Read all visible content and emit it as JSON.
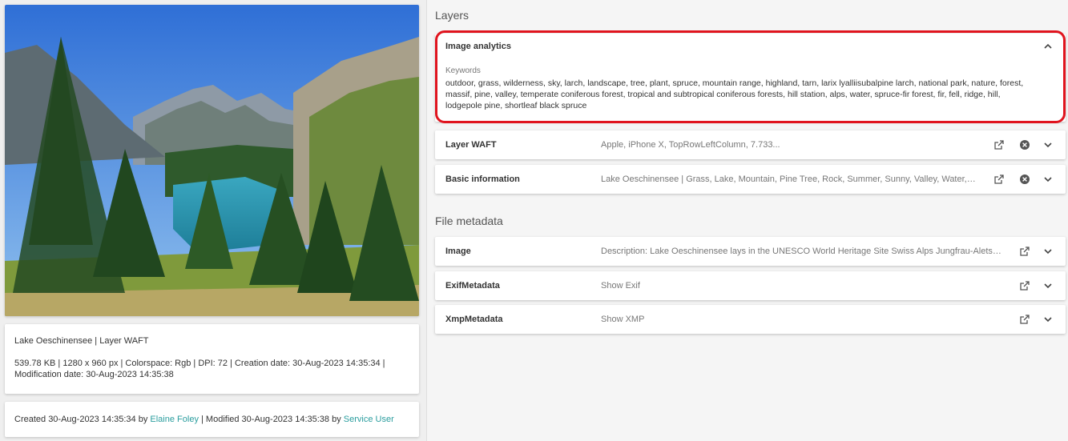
{
  "left": {
    "info_title": "Lake Oeschinensee | Layer WAFT",
    "info_details": "539.78 KB | 1280 x 960 px | Colorspace: Rgb | DPI: 72 | Creation date: 30-Aug-2023 14:35:34 | Modification date: 30-Aug-2023 14:35:38",
    "created_prefix": "Created 30-Aug-2023 14:35:34 by ",
    "created_by": "Elaine Foley",
    "modified_prefix": " | Modified 30-Aug-2023 14:35:38 by ",
    "modified_by": "Service User"
  },
  "layers": {
    "section_title": "Layers",
    "image_analytics": {
      "title": "Image analytics",
      "keywords_label": "Keywords",
      "keywords": "outdoor, grass, wilderness, sky, larch, landscape, tree, plant, spruce, mountain range, highland, tarn, larix lyalliisubalpine larch, national park, nature, forest, massif, pine, valley, temperate coniferous forest, tropical and subtropical coniferous forests, hill station, alps, water, spruce-fir forest, fir, fell, ridge, hill, lodgepole pine, shortleaf black spruce"
    },
    "layer_waft": {
      "title": "Layer WAFT",
      "summary": "Apple, iPhone X, TopRowLeftColumn, 7.733..."
    },
    "basic_information": {
      "title": "Basic information",
      "summary": "Lake Oeschinensee | Grass, Lake, Mountain, Pine Tree, Rock, Summer, Sunny, Valley, Water, Unesco ..."
    }
  },
  "file_metadata": {
    "section_title": "File metadata",
    "image": {
      "title": "Image",
      "summary": "Description: Lake Oeschinensee lays in the UNESCO World Heritage Site Swiss Alps Jungfrau-Aletsch just a..."
    },
    "exif": {
      "title": "ExifMetadata",
      "summary": "Show Exif"
    },
    "xmp": {
      "title": "XmpMetadata",
      "summary": "Show XMP"
    }
  },
  "colors": {
    "accent_link": "#2a9d9e",
    "highlight": "#e0141e"
  }
}
